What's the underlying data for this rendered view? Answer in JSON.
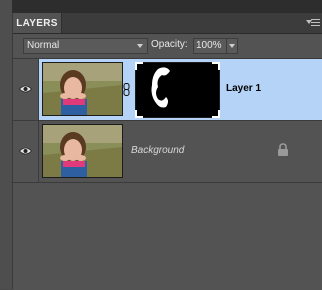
{
  "panel": {
    "tab_label": "LAYERS",
    "menu_icon": "panel-menu-icon"
  },
  "toolbar": {
    "blend_mode": "Normal",
    "opacity_label": "Opacity:",
    "opacity_value": "100%"
  },
  "layers": [
    {
      "name": "Layer 1",
      "selected": true,
      "visible": true,
      "has_mask": true,
      "linked": true
    },
    {
      "name": "Background",
      "selected": false,
      "visible": true,
      "locked": true
    }
  ],
  "colors": {
    "selected_row": "#b4d3f6",
    "panel_bg": "#535353"
  },
  "icons": [
    "eye-icon",
    "chain-link-icon",
    "lock-icon",
    "dropdown-arrow-icon",
    "panel-menu-icon"
  ]
}
